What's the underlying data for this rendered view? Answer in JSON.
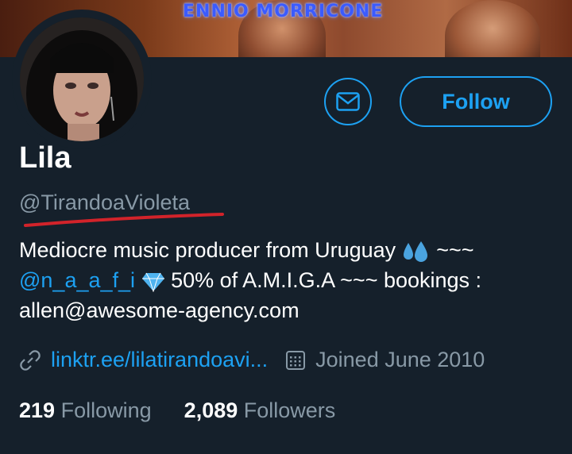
{
  "colors": {
    "background": "#15202b",
    "accent": "#1da1f2",
    "secondary_text": "#8899a6",
    "primary_text": "#ffffff",
    "annotation_red": "#d2232a"
  },
  "banner": {
    "text": "ENNIO MORRICONE"
  },
  "profile": {
    "name": "Lila",
    "handle": "@TirandoaVioleta",
    "bio": {
      "line1_text": "Mediocre music producer from Uruguay",
      "line1_emoji": "sweat-droplets",
      "line1_tail": "~~~",
      "mention": "@n_a_a_f_i",
      "line2_emoji": "gem",
      "line2_text": "50% of A.M.I.G.A ~~~ bookings :",
      "line3_text": "allen@awesome-agency.com"
    },
    "link_text": "linktr.ee/lilatirandoavi...",
    "joined_text": "Joined June 2010",
    "following_count": "219",
    "following_label": "Following",
    "followers_count": "2,089",
    "followers_label": "Followers"
  },
  "actions": {
    "follow_label": "Follow",
    "message_icon": "mail-icon"
  },
  "icons": {
    "link": "link-icon",
    "calendar": "calendar-icon"
  }
}
